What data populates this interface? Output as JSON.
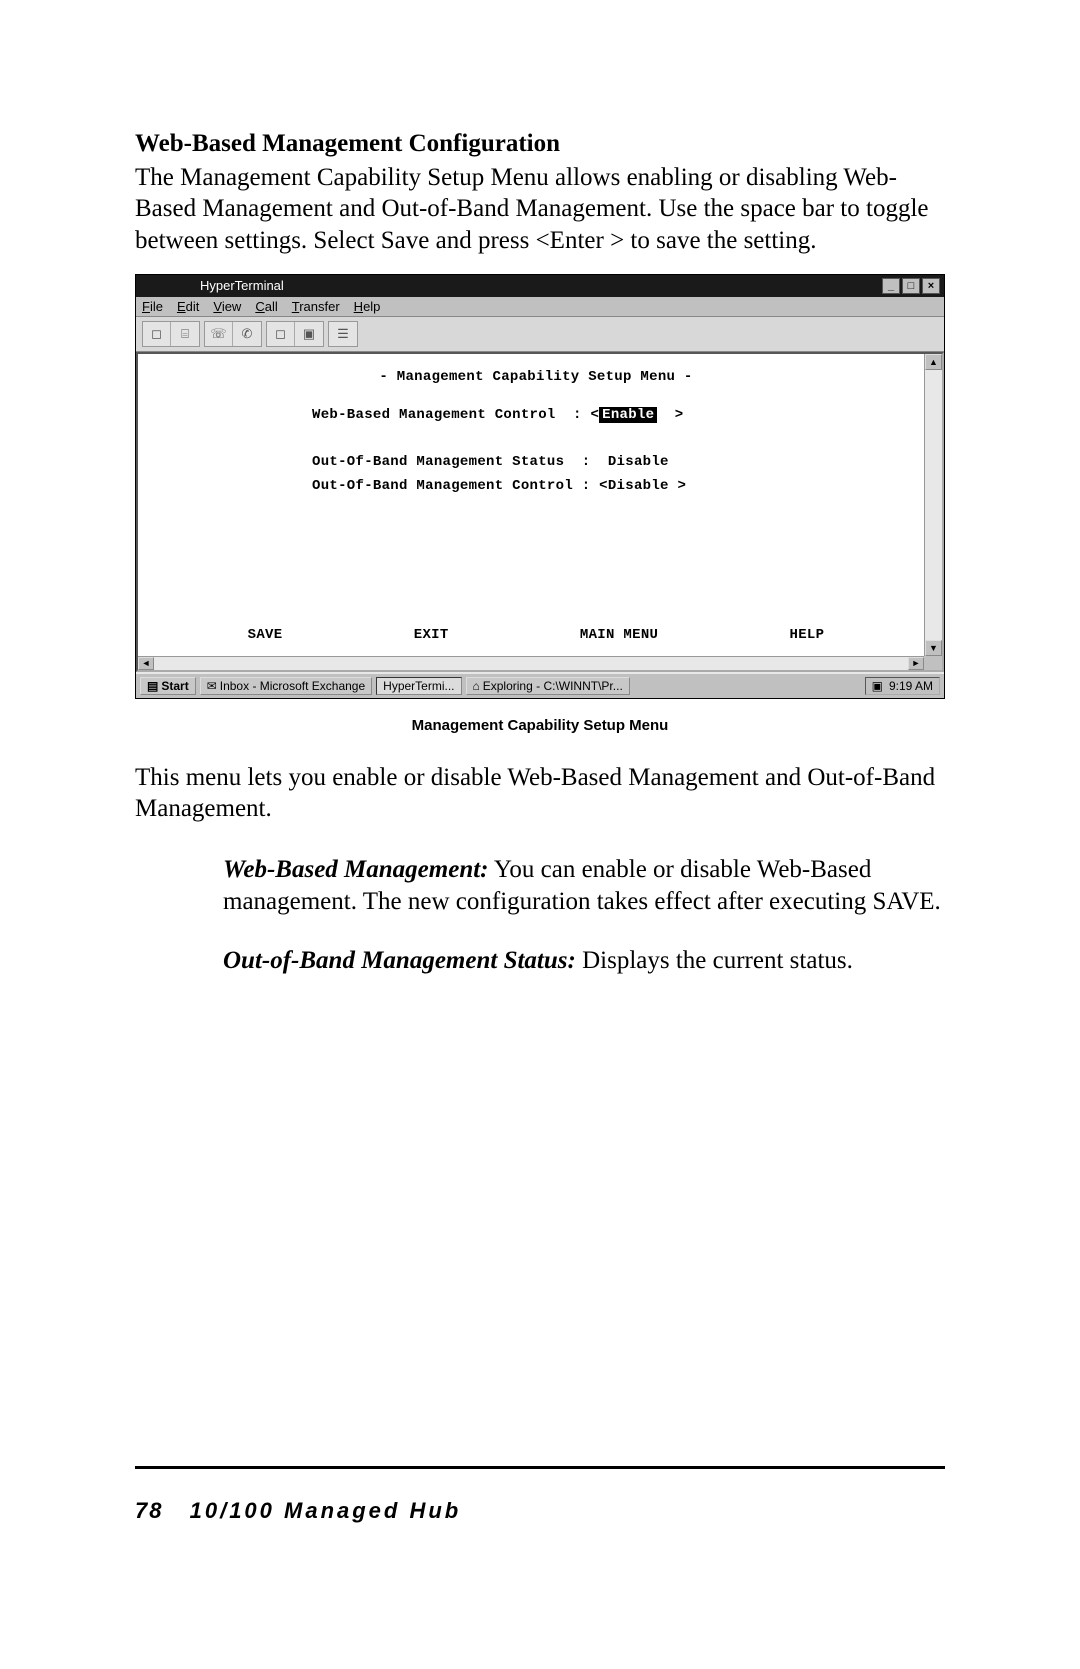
{
  "section": {
    "heading": "Web-Based Management Configuration",
    "p1": "The Management Capability Setup Menu allows enabling or disabling Web-Based Management and Out-of-Band Management. Use the space bar to toggle between settings. Select Save and press <Enter > to save the setting."
  },
  "window": {
    "title": "HyperTerminal",
    "menus": {
      "file": "File",
      "edit": "Edit",
      "view": "View",
      "call": "Call",
      "transfer": "Transfer",
      "help": "Help"
    }
  },
  "terminal": {
    "title": "- Management Capability Setup Menu -",
    "f1_label": "Web-Based Management Control  : <",
    "f1_value": "Enable",
    "f1_close": "  >",
    "f2": "Out-Of-Band Management Status  :  Disable",
    "f3": "Out-Of-Band Management Control : <Disable >",
    "actions": {
      "save": "SAVE",
      "exit": "EXIT",
      "main": "MAIN MENU",
      "help": "HELP"
    }
  },
  "taskbar": {
    "start": "Start",
    "task1": "Inbox - Microsoft Exchange",
    "task2": "HyperTermi...",
    "task3": "Exploring - C:\\WINNT\\Pr...",
    "time": "9:19 AM"
  },
  "caption": "Management Capability Setup Menu",
  "p2": "This menu lets you enable or disable Web-Based Management and Out-of-Band Management.",
  "item1_label": "Web-Based Management:",
  "item1_text": " You can enable or disable Web-Based management. The new configuration takes effect after executing SAVE.",
  "item2_label": "Out-of-Band Management Status:",
  "item2_text": " Displays the current status.",
  "footer": {
    "page": "78",
    "title": "10/100 Managed Hub"
  }
}
